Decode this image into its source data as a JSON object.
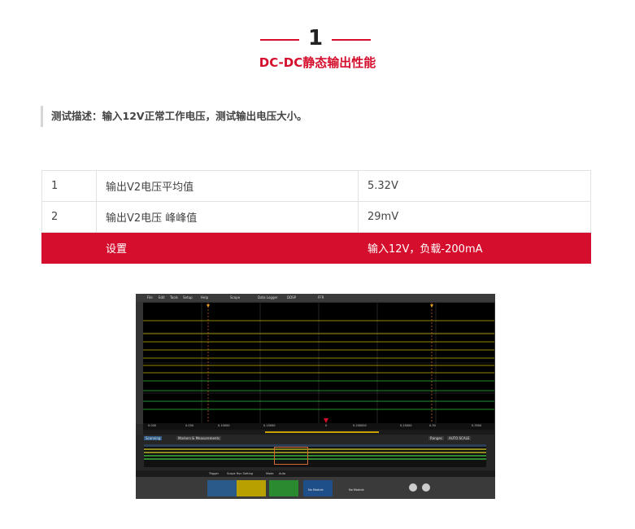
{
  "section": {
    "number": "1",
    "title": "DC-DC静态输出性能"
  },
  "description": "测试描述：输入12V正常工作电压，测试输出电压大小。",
  "table": {
    "rows": [
      {
        "idx": "1",
        "item": "输出V2电压平均值",
        "value": "5.32V"
      },
      {
        "idx": "2",
        "item": "输出V2电压  峰峰值",
        "value": "29mV"
      },
      {
        "idx": "",
        "item": "设置",
        "value": "输入12V，负载-200mA"
      }
    ]
  },
  "scope": {
    "menu": [
      "File",
      "Edit",
      "Tools",
      "Setup",
      "Help",
      "Scope",
      "Data Logger",
      "DDSP",
      "FFR"
    ],
    "axis_ticks": [
      "0.000",
      "0.050",
      "0.10000",
      "0.15000",
      "0",
      "0.200000",
      "0.25000",
      "0.30",
      "0.3500"
    ],
    "panel_tabs": [
      "Scanning",
      "Markers & Measurements"
    ],
    "buttons": [
      "Ranges",
      "AUTO SCALE"
    ],
    "status": [
      "Trigger",
      "Scope Run Setting",
      "Mode",
      "Auto"
    ],
    "bottom_labels": [
      "No Module",
      "No Module"
    ],
    "colors": {
      "red": "#d40e2c",
      "trace_yellow": "#c8b400",
      "trace_green": "#2fbf3a",
      "grid": "#555555"
    }
  }
}
